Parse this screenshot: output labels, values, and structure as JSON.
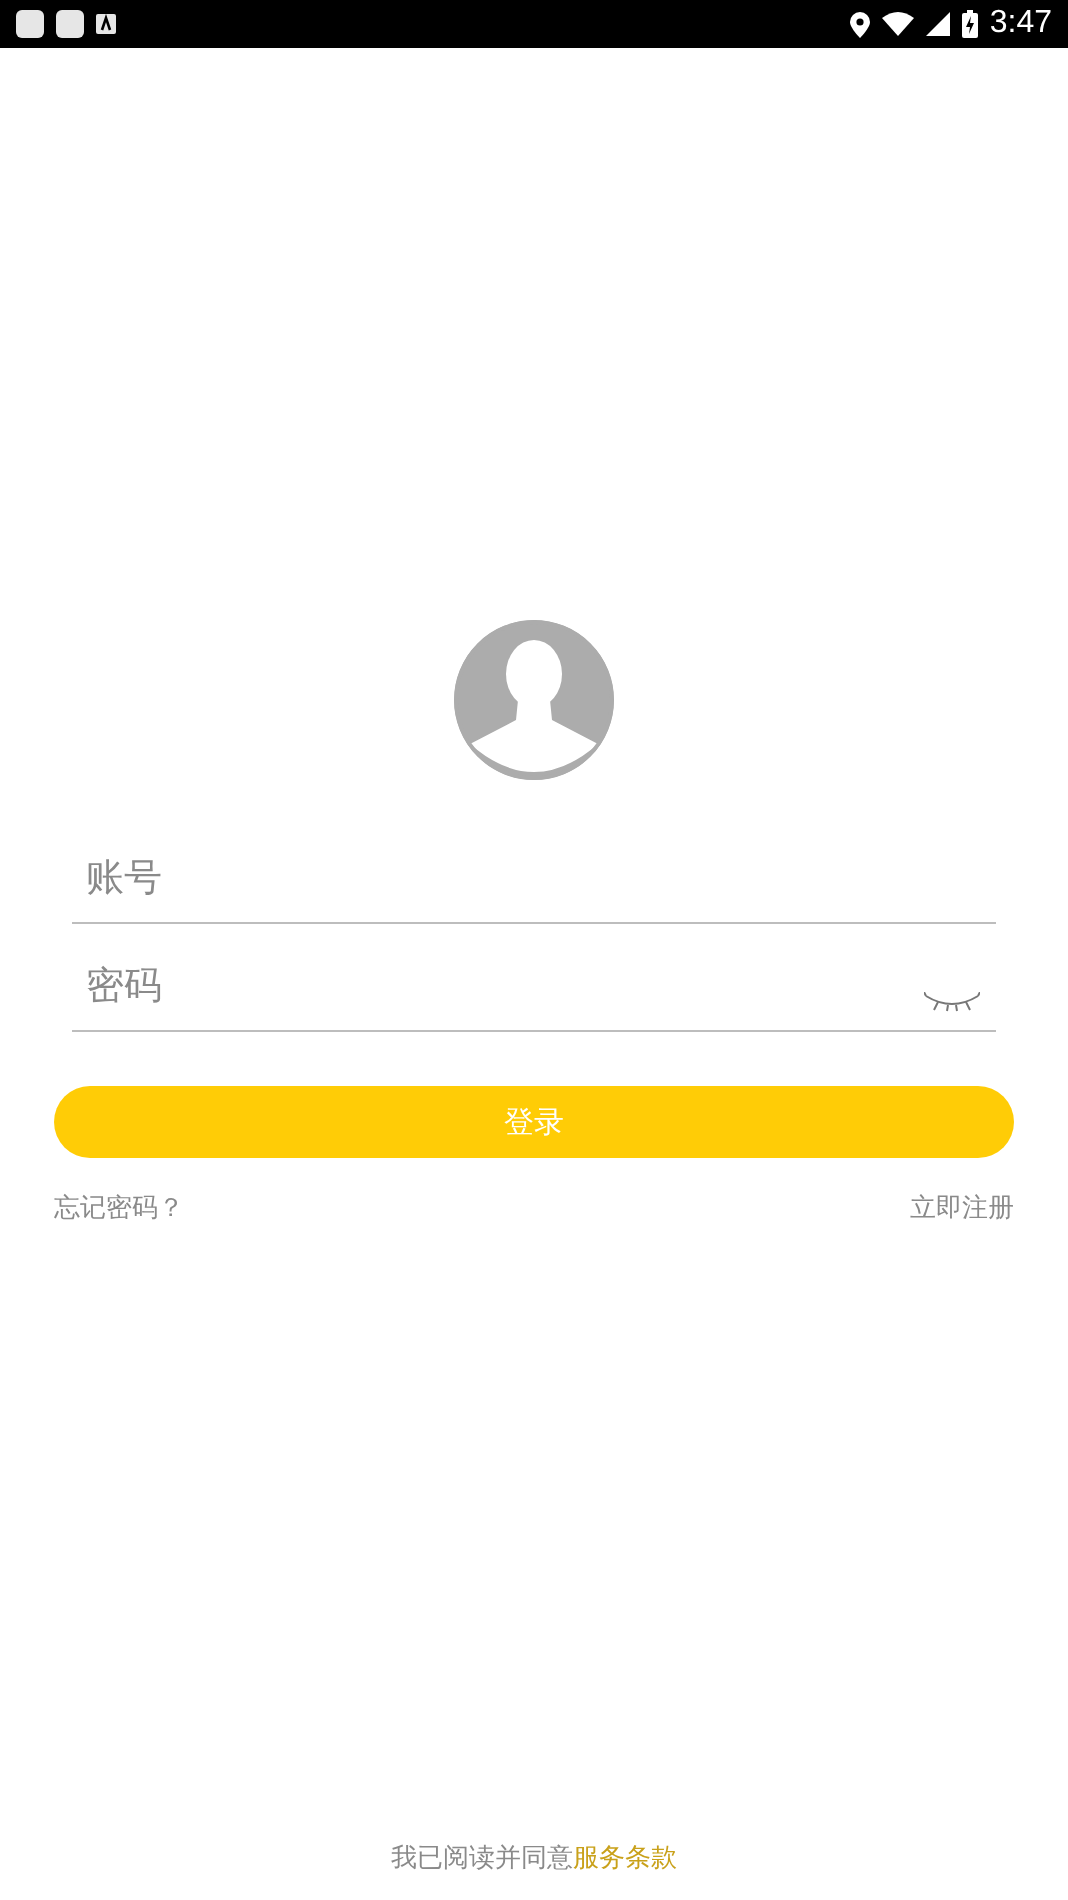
{
  "status_bar": {
    "time": "3:47"
  },
  "form": {
    "account": {
      "placeholder": "账号"
    },
    "password": {
      "placeholder": "密码"
    },
    "login_button": "登录",
    "forgot_link": "忘记密码？",
    "register_link": "立即注册"
  },
  "footer": {
    "notice": "我已阅读并同意",
    "terms_link": "服务条款"
  }
}
